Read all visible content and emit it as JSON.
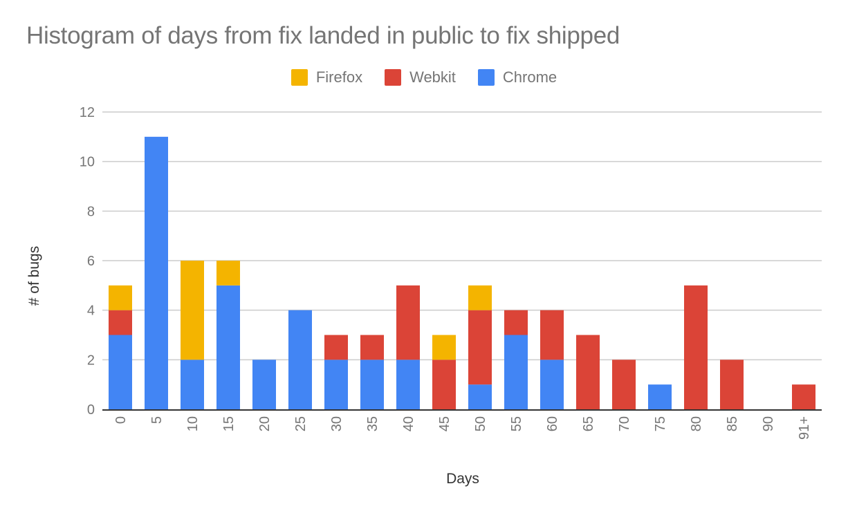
{
  "chart_data": {
    "type": "bar",
    "stacked": true,
    "title": "Histogram of days from fix landed in public to fix shipped",
    "xlabel": "Days",
    "ylabel": "# of bugs",
    "ylim": [
      0,
      12
    ],
    "yticks": [
      "0",
      "2",
      "4",
      "6",
      "8",
      "10",
      "12"
    ],
    "grid": true,
    "legend_position": "top",
    "categories": [
      "0",
      "5",
      "10",
      "15",
      "20",
      "25",
      "30",
      "35",
      "40",
      "45",
      "50",
      "55",
      "60",
      "65",
      "70",
      "75",
      "80",
      "85",
      "90",
      "91+"
    ],
    "series": [
      {
        "name": "Chrome",
        "color": "#4285f4",
        "values": [
          3,
          11,
          2,
          5,
          2,
          4,
          2,
          2,
          2,
          0,
          1,
          3,
          2,
          0,
          0,
          1,
          0,
          0,
          0,
          0
        ]
      },
      {
        "name": "Webkit",
        "color": "#db4437",
        "values": [
          1,
          0,
          0,
          0,
          0,
          0,
          1,
          1,
          3,
          2,
          3,
          1,
          2,
          3,
          2,
          0,
          5,
          2,
          0,
          1
        ]
      },
      {
        "name": "Firefox",
        "color": "#f4b400",
        "values": [
          1,
          0,
          4,
          1,
          0,
          0,
          0,
          0,
          0,
          1,
          1,
          0,
          0,
          0,
          0,
          0,
          0,
          0,
          0,
          0
        ]
      }
    ],
    "legend_order": [
      "Firefox",
      "Webkit",
      "Chrome"
    ]
  }
}
